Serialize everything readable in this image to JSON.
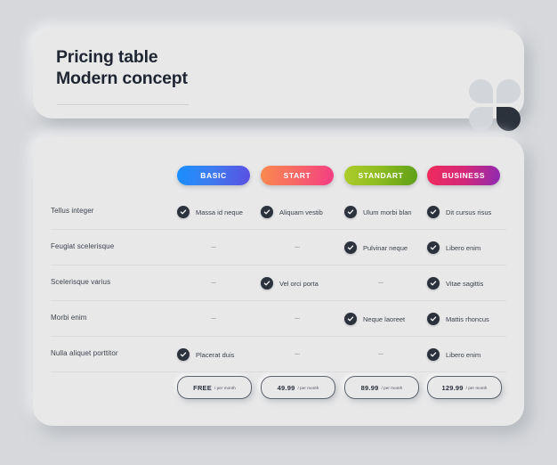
{
  "header": {
    "title_line1": "Pricing table",
    "title_line2": "Modern concept",
    "logo_name": "four-petal-flower-logo"
  },
  "plans": [
    {
      "label": "BASIC",
      "color_from": "#1790ff",
      "color_to": "#5a4fe2"
    },
    {
      "label": "START",
      "color_from": "#fa8a4e",
      "color_to": "#f43d84"
    },
    {
      "label": "STANDART",
      "color_from": "#aecd2a",
      "color_to": "#5d9e17"
    },
    {
      "label": "BUSINESS",
      "color_from": "#f02a5c",
      "color_to": "#8d2ab2"
    }
  ],
  "features": [
    {
      "label": "Tellus integer",
      "cells": [
        {
          "included": true,
          "text": "Massa id neque"
        },
        {
          "included": true,
          "text": "Aliquam vestib"
        },
        {
          "included": true,
          "text": "Ulum morbi blan"
        },
        {
          "included": true,
          "text": "Dit cursus risus"
        }
      ]
    },
    {
      "label": "Feugiat scelerisque",
      "cells": [
        {
          "included": false,
          "text": "–"
        },
        {
          "included": false,
          "text": "–"
        },
        {
          "included": true,
          "text": "Pulvinar neque"
        },
        {
          "included": true,
          "text": "Libero enim"
        }
      ]
    },
    {
      "label": "Scelerisque varius",
      "cells": [
        {
          "included": false,
          "text": "–"
        },
        {
          "included": true,
          "text": "Vel orci porta"
        },
        {
          "included": false,
          "text": "–"
        },
        {
          "included": true,
          "text": "Vitae sagittis"
        }
      ]
    },
    {
      "label": "Morbi enim",
      "cells": [
        {
          "included": false,
          "text": "–"
        },
        {
          "included": false,
          "text": "–"
        },
        {
          "included": true,
          "text": "Neque laoreet"
        },
        {
          "included": true,
          "text": "Mattis rhoncus"
        }
      ]
    },
    {
      "label": "Nulla aliquet porttitor",
      "cells": [
        {
          "included": true,
          "text": "Placerat duis"
        },
        {
          "included": false,
          "text": "–"
        },
        {
          "included": false,
          "text": "–"
        },
        {
          "included": true,
          "text": "Libero enim"
        }
      ]
    }
  ],
  "prices": [
    {
      "amount": "FREE",
      "period": "/ per month"
    },
    {
      "amount": "49.99",
      "period": "/ per month"
    },
    {
      "amount": "89.99",
      "period": "/ per month"
    },
    {
      "amount": "129.99",
      "period": "/ per month"
    }
  ],
  "colors": {
    "page_background": "#d6d8db",
    "card_background": "#e8e8e9",
    "text_dark": "#1f2632",
    "text_body": "#3b424c",
    "check_circle": "#2b323c",
    "separator": "#dcdcde"
  }
}
